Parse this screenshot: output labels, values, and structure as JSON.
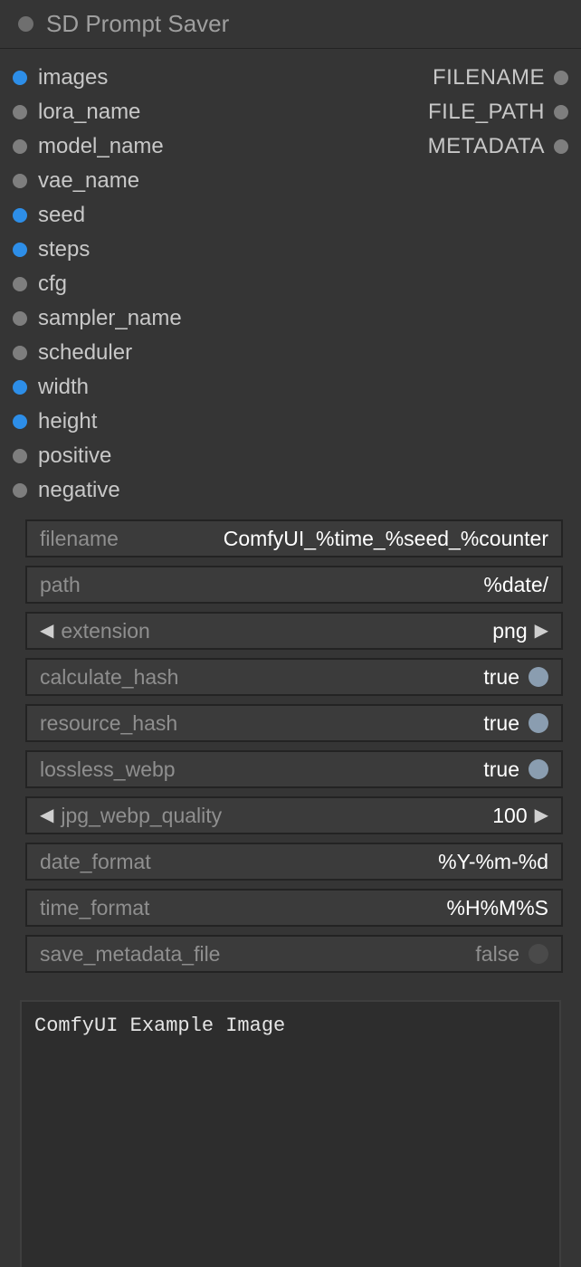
{
  "title": "SD Prompt Saver",
  "colors": {
    "socket_blue": "#2d8ee8",
    "socket_gray": "#7e7e7e"
  },
  "inputs": [
    {
      "name": "images",
      "kind": "blue"
    },
    {
      "name": "lora_name",
      "kind": "gray"
    },
    {
      "name": "model_name",
      "kind": "gray"
    },
    {
      "name": "vae_name",
      "kind": "gray"
    },
    {
      "name": "seed",
      "kind": "blue"
    },
    {
      "name": "steps",
      "kind": "blue"
    },
    {
      "name": "cfg",
      "kind": "gray"
    },
    {
      "name": "sampler_name",
      "kind": "gray"
    },
    {
      "name": "scheduler",
      "kind": "gray"
    },
    {
      "name": "width",
      "kind": "blue"
    },
    {
      "name": "height",
      "kind": "blue"
    },
    {
      "name": "positive",
      "kind": "gray"
    },
    {
      "name": "negative",
      "kind": "gray"
    }
  ],
  "outputs": [
    {
      "name": "FILENAME"
    },
    {
      "name": "FILE_PATH"
    },
    {
      "name": "METADATA"
    }
  ],
  "widgets": {
    "filename": {
      "label": "filename",
      "value": "ComfyUI_%time_%seed_%counter"
    },
    "path": {
      "label": "path",
      "value": "%date/"
    },
    "extension": {
      "label": "extension",
      "value": "png"
    },
    "calculate_hash": {
      "label": "calculate_hash",
      "value": "true",
      "on": true
    },
    "resource_hash": {
      "label": "resource_hash",
      "value": "true",
      "on": true
    },
    "lossless_webp": {
      "label": "lossless_webp",
      "value": "true",
      "on": true
    },
    "jpg_webp_quality": {
      "label": "jpg_webp_quality",
      "value": "100"
    },
    "date_format": {
      "label": "date_format",
      "value": "%Y-%m-%d"
    },
    "time_format": {
      "label": "time_format",
      "value": "%H%M%S"
    },
    "save_metadata_file": {
      "label": "save_metadata_file",
      "value": "false",
      "on": false
    }
  },
  "textarea": "ComfyUI Example Image"
}
